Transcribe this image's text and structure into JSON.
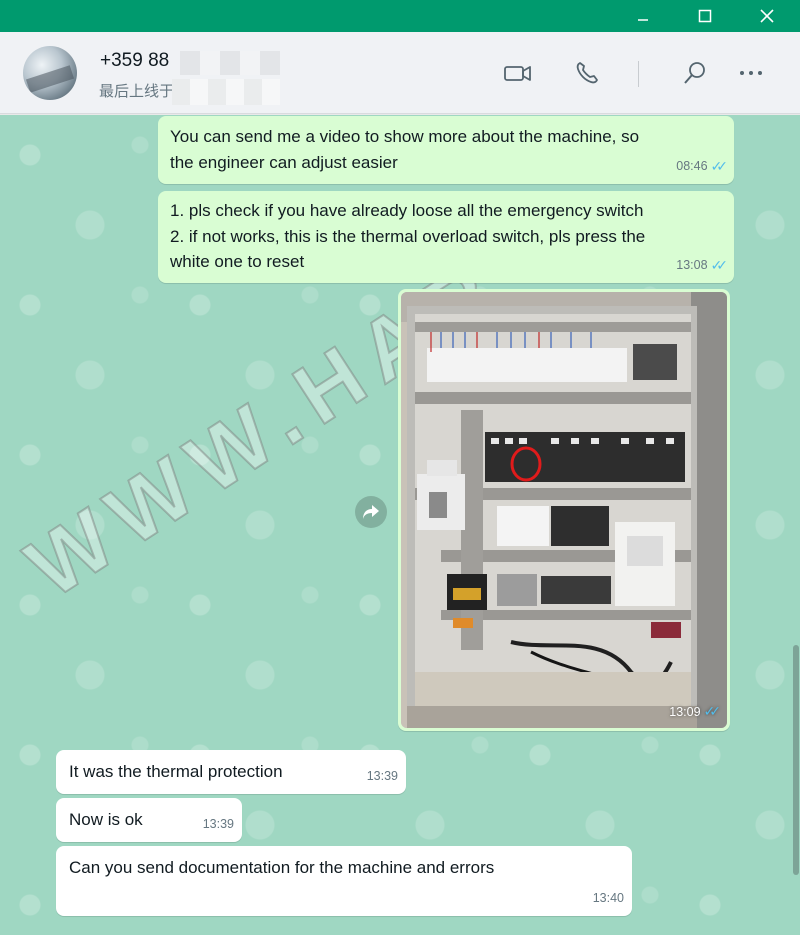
{
  "window": {
    "minimize_icon": "minimize-icon",
    "maximize_icon": "maximize-icon",
    "close_icon": "close-icon",
    "accent": "#009a6e"
  },
  "header": {
    "contact_name": "+359 88",
    "status": "最后上线于",
    "icons": [
      "video-call-icon",
      "voice-call-icon",
      "search-icon",
      "menu-icon"
    ]
  },
  "watermark": "WWW.HAR",
  "messages": {
    "m1": {
      "lines": [
        "You can send me a video to show more about the machine, so",
        "the engineer can adjust easier"
      ],
      "time": "08:46"
    },
    "m2": {
      "lines": [
        "1. pls check if you have already loose all the emergency switch",
        "2. if not works, this is the thermal overload switch, pls press the",
        "white one to reset"
      ],
      "time": "13:08"
    },
    "m3": {
      "type": "image",
      "description": "electrical-panel-photo",
      "time": "13:09"
    },
    "m4": {
      "text": "It was the thermal protection",
      "time": "13:39"
    },
    "m5": {
      "text": "Now is ok",
      "time": "13:39"
    },
    "m6": {
      "text": "Can you send documentation for the machine and errors",
      "time": "13:40"
    }
  },
  "colors": {
    "outgoing": "#d9fdd3",
    "incoming": "#ffffff",
    "read_ticks": "#53bdeb",
    "chat_bg": "#9fd7c2"
  }
}
